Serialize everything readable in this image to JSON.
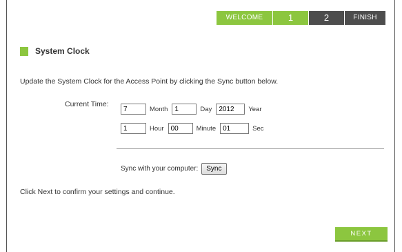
{
  "wizard": {
    "steps": [
      "WELCOME",
      "1",
      "2",
      "FINISH"
    ],
    "active_step": "2",
    "colors": {
      "done": "#8cc63f",
      "pending": "#4d4d4d"
    }
  },
  "section": {
    "title": "System Clock",
    "accent_color": "#8cc63f"
  },
  "description": "Update the System Clock for the Access Point by clicking the Sync button below.",
  "current_time": {
    "label": "Current Time:",
    "month": {
      "value": "7",
      "unit": "Month"
    },
    "day": {
      "value": "1",
      "unit": "Day"
    },
    "year": {
      "value": "2012",
      "unit": "Year"
    },
    "hour": {
      "value": "1",
      "unit": "Hour"
    },
    "minute": {
      "value": "00",
      "unit": "Minute"
    },
    "sec": {
      "value": "01",
      "unit": "Sec"
    }
  },
  "sync": {
    "label": "Sync with your computer:",
    "button": "Sync"
  },
  "confirm_text": "Click Next to confirm your settings and continue.",
  "next_button": "NEXT"
}
